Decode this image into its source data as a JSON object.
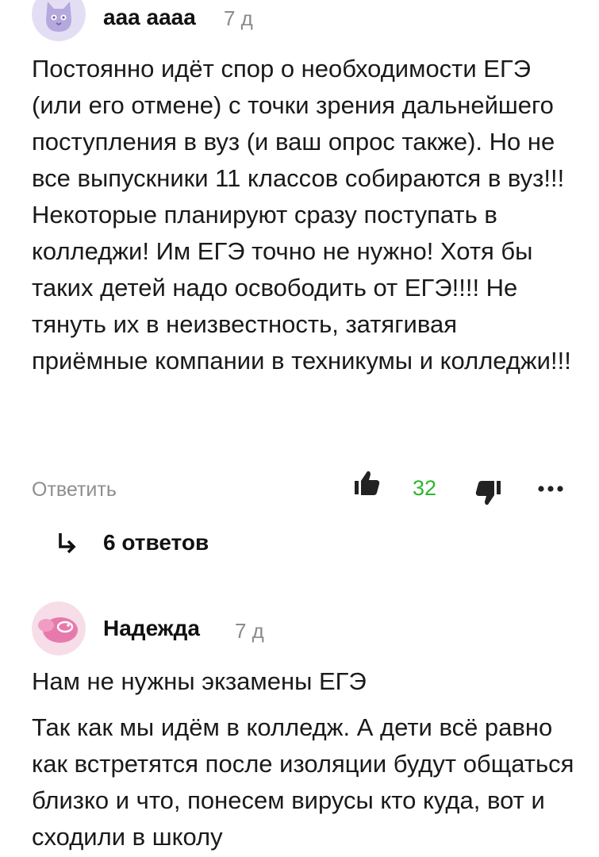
{
  "comments": [
    {
      "author": "ааа аааа",
      "time": "7 д",
      "text": "Постоянно идёт спор о необходимости ЕГЭ (или его отмене) с точки зрения дальнейшего поступления в вуз (и ваш опрос также). Но не все выпускники 11 классов собираются в вуз!!! Некоторые планируют сразу поступать в колледжи! Им ЕГЭ точно не нужно! Хотя бы таких детей надо освободить от ЕГЭ!!!! Не тянуть их в неизвестность, затягивая приёмные компании в техникумы и колледжи!!!",
      "reply_label": "Ответить",
      "likes": "32",
      "replies_label": "6 ответов"
    },
    {
      "author": "Надежда",
      "time": "7 д",
      "text_para1": "Нам не нужны экзамены ЕГЭ",
      "text_para2": "Так как мы идём в колледж. А дети всё равно как встретятся после изоляции будут общаться близко и что, понесем вирусы кто куда, вот и сходили в школу"
    }
  ],
  "colors": {
    "like_count": "#2db52d",
    "meta_gray": "#8a8a8a",
    "avatar1_bg": "#e3def4",
    "avatar2_bg": "#f6dde8"
  },
  "icons": {
    "like": "thumbs-up-icon",
    "dislike": "thumbs-down-icon",
    "more": "more-dots-icon",
    "replies": "reply-arrow-icon"
  }
}
